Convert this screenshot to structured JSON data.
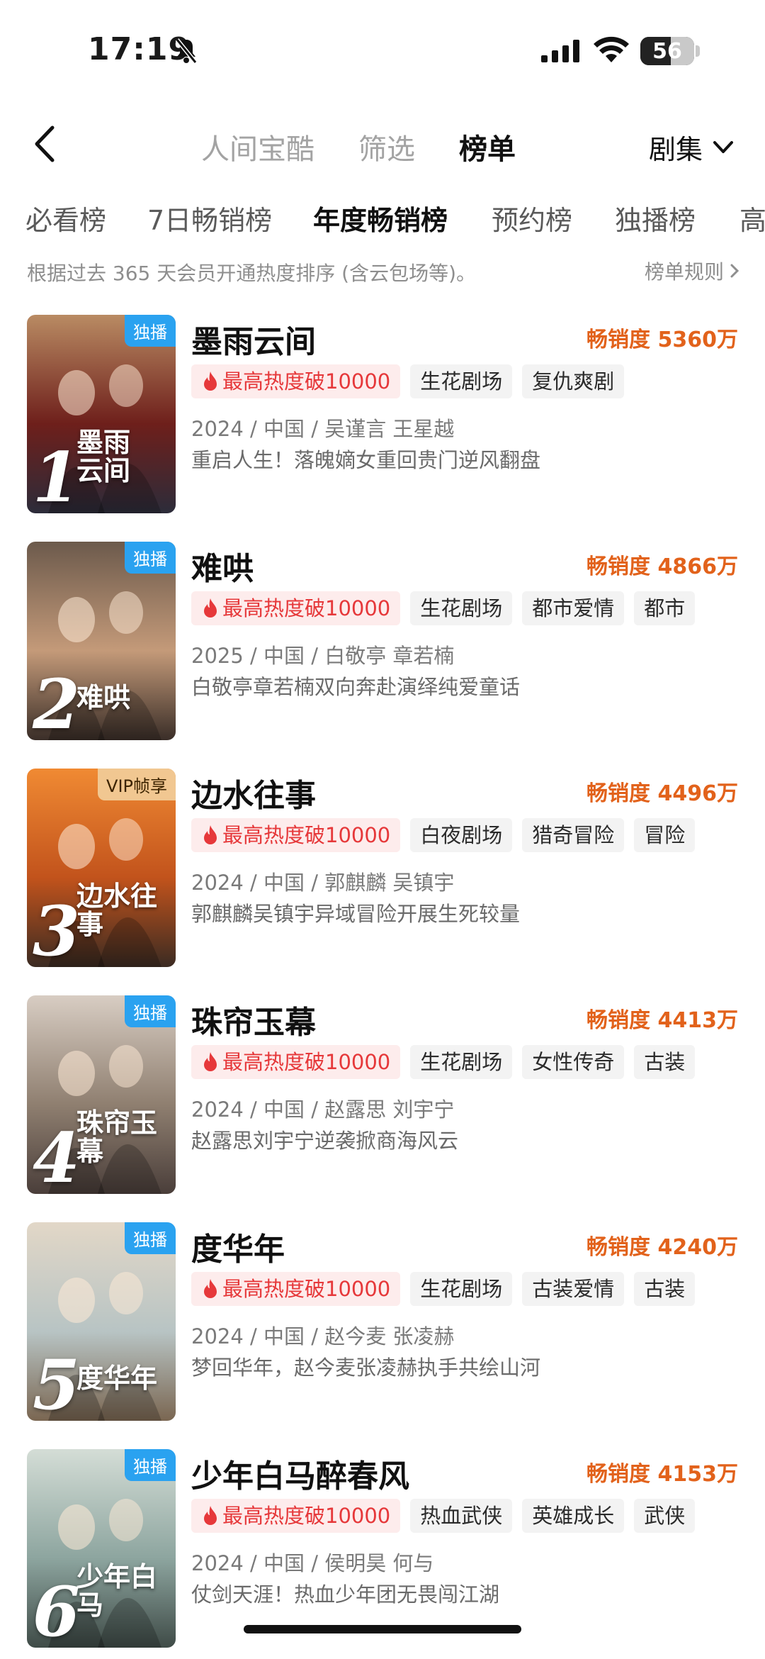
{
  "status_bar": {
    "time": "17:19",
    "battery": "56",
    "battery_level": 0.56
  },
  "header": {
    "back_icon": "chevron-left-icon",
    "nav": [
      "人间宝酷",
      "筛选",
      "榜单"
    ],
    "active_nav": "榜单",
    "series_select": "剧集"
  },
  "tabs": [
    "必看榜",
    "7日畅销榜",
    "年度畅销榜",
    "预约榜",
    "独播榜",
    "高"
  ],
  "active_tab": "年度畅销榜",
  "description": "根据过去 365 天会员开通热度排序 (含云包场等)。",
  "rules_link": "榜单规则",
  "colors": {
    "accent_orange": "#e2621b",
    "hot_red": "#e6383a",
    "badge_blue": "#2aa2f0",
    "badge_vip": "#f1c791"
  },
  "items": [
    {
      "rank": "1",
      "badge": "独播",
      "poster_title": "墨雨\n云间",
      "title": "墨雨云间",
      "sales": "畅销度 5360万",
      "hot": "最高热度破10000",
      "tags": [
        "生花剧场",
        "复仇爽剧"
      ],
      "meta": "2024 / 中国 / 吴谨言 王星越",
      "blurb": "重启人生！落魄嫡女重回贵门逆风翻盘"
    },
    {
      "rank": "2",
      "badge": "独播",
      "poster_title": "难哄",
      "title": "难哄",
      "sales": "畅销度 4866万",
      "hot": "最高热度破10000",
      "tags": [
        "生花剧场",
        "都市爱情",
        "都市"
      ],
      "meta": "2025 / 中国 / 白敬亭 章若楠",
      "blurb": "白敬亭章若楠双向奔赴演绎纯爱童话"
    },
    {
      "rank": "3",
      "badge": "VIP帧享",
      "poster_title": "边水往事",
      "title": "边水往事",
      "sales": "畅销度 4496万",
      "hot": "最高热度破10000",
      "tags": [
        "白夜剧场",
        "猎奇冒险",
        "冒险"
      ],
      "meta": "2024 / 中国 / 郭麒麟 吴镇宇",
      "blurb": "郭麒麟吴镇宇异域冒险开展生死较量"
    },
    {
      "rank": "4",
      "badge": "独播",
      "poster_title": "珠帘玉幕",
      "title": "珠帘玉幕",
      "sales": "畅销度 4413万",
      "hot": "最高热度破10000",
      "tags": [
        "生花剧场",
        "女性传奇",
        "古装"
      ],
      "meta": "2024 / 中国 / 赵露思 刘宇宁",
      "blurb": "赵露思刘宇宁逆袭掀商海风云"
    },
    {
      "rank": "5",
      "badge": "独播",
      "poster_title": "度华年",
      "title": "度华年",
      "sales": "畅销度 4240万",
      "hot": "最高热度破10000",
      "tags": [
        "生花剧场",
        "古装爱情",
        "古装"
      ],
      "meta": "2024 / 中国 / 赵今麦 张凌赫",
      "blurb": "梦回华年，赵今麦张凌赫执手共绘山河"
    },
    {
      "rank": "6",
      "badge": "独播",
      "poster_title": "少年白马",
      "title": "少年白马醉春风",
      "sales": "畅销度 4153万",
      "hot": "最高热度破10000",
      "tags": [
        "热血武侠",
        "英雄成长",
        "武侠"
      ],
      "meta": "2024 / 中国 / 侯明昊 何与",
      "blurb": "仗剑天涯！热血少年团无畏闯江湖"
    }
  ]
}
